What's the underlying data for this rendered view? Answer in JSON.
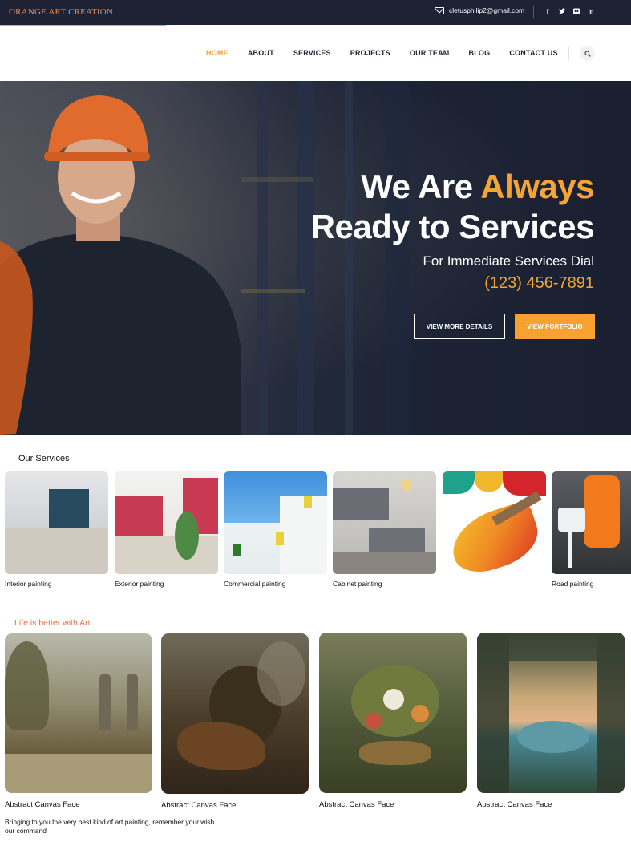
{
  "topbar": {
    "brand": "ORANGE ART CREATION",
    "email": "cletusphilip2@gmail.com",
    "email_icon": "mail-icon",
    "socials": [
      {
        "name": "facebook-icon",
        "glyph": "f"
      },
      {
        "name": "twitter-icon",
        "glyph": "t"
      },
      {
        "name": "flickr-icon",
        "glyph": "●●"
      },
      {
        "name": "linkedin-icon",
        "glyph": "in"
      }
    ]
  },
  "nav": {
    "items": [
      "HOME",
      "ABOUT",
      "SERVICES",
      "PROJECTS",
      "OUR TEAM",
      "BLOG",
      "CONTACT US"
    ],
    "active": "HOME",
    "search_icon": "search-icon"
  },
  "hero": {
    "title_part1": "We Are ",
    "title_accent": "Always",
    "title_line2": "Ready to Services",
    "subtitle": "For Immediate Services Dial",
    "phone": "(123) 456-7891",
    "btn_details": "VIEW MORE DETAILS",
    "btn_portfolio": "VIEW PORTFOLIO"
  },
  "services": {
    "title": "Our Services",
    "items": [
      {
        "label": "Interior painting"
      },
      {
        "label": "Exterior painting"
      },
      {
        "label": "Commercial painting"
      },
      {
        "label": "Cabinet painting"
      },
      {
        "label": ""
      },
      {
        "label": "Road painting"
      }
    ]
  },
  "art": {
    "title": "Life is better with Art",
    "items": [
      {
        "label": "Abstract Canvas Face"
      },
      {
        "label": "Abstract Canvas Face"
      },
      {
        "label": "Abstract Canvas Face"
      },
      {
        "label": "Abstract Canvas Face"
      }
    ],
    "tagline": "Bringing to you the very best kind of art painting, remember your wish our command"
  },
  "colors": {
    "dark": "#1f2235",
    "accent": "#f5a533",
    "brand": "#f08a4b",
    "art_title": "#e7703f"
  }
}
